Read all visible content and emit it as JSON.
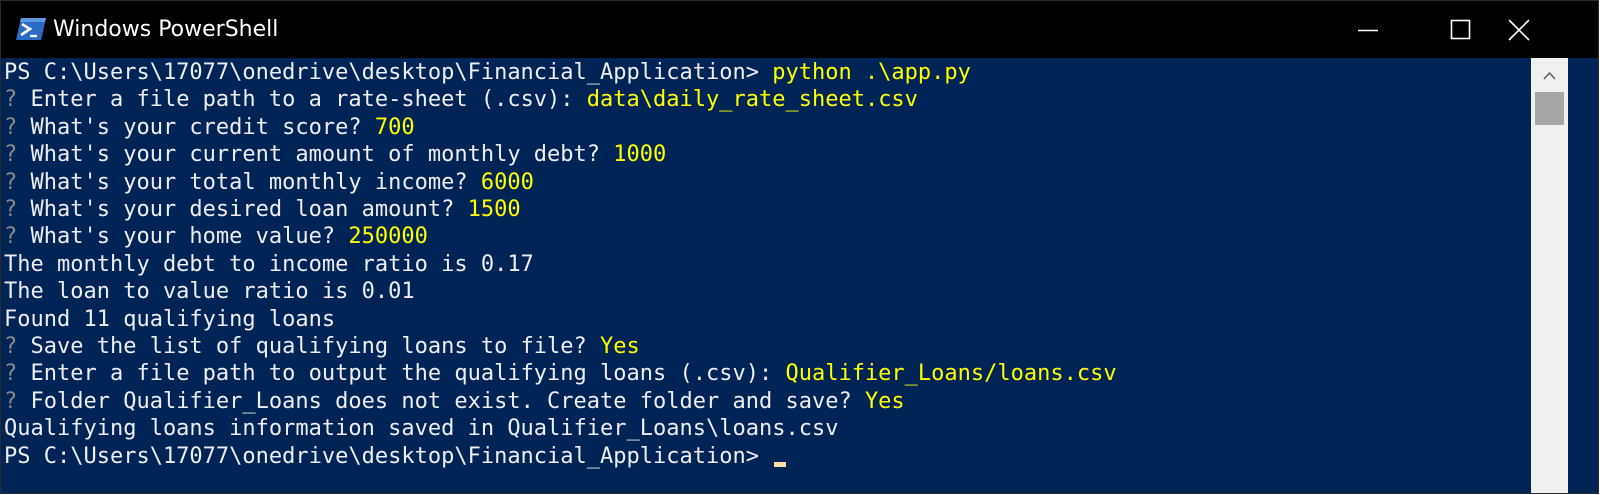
{
  "window": {
    "title": "Windows PowerShell",
    "icon": "powershell-icon",
    "controls": [
      "minimize-icon",
      "maximize-icon",
      "close-icon"
    ]
  },
  "colors": {
    "console_bg": "#012456",
    "text": "#eeedf0",
    "highlight": "#ffff00",
    "prompt_marker": "#8a8a8a",
    "titlebar_bg": "#000000",
    "cursor": "#fedba9"
  },
  "console": {
    "lines": [
      {
        "prefix": "PS C:\\Users\\17077\\onedrive\\desktop\\Financial_Application> ",
        "value": "python .\\app.py"
      },
      {
        "prefix": " Enter a file path to a rate-sheet (.csv): ",
        "value": "data\\daily_rate_sheet.csv"
      },
      {
        "prefix": " What's your credit score? ",
        "value": "700"
      },
      {
        "prefix": " What's your current amount of monthly debt? ",
        "value": "1000"
      },
      {
        "prefix": " What's your total monthly income? ",
        "value": "6000"
      },
      {
        "prefix": " What's your desired loan amount? ",
        "value": "1500"
      },
      {
        "prefix": " What's your home value? ",
        "value": "250000"
      },
      {
        "text": "The monthly debt to income ratio is 0.17"
      },
      {
        "text": "The loan to value ratio is 0.01"
      },
      {
        "text": "Found 11 qualifying loans"
      },
      {
        "prefix": " Save the list of qualifying loans to file? ",
        "value": "Yes"
      },
      {
        "prefix": " Enter a file path to output the qualifying loans (.csv): ",
        "value": "Qualifier_Loans/loans.csv"
      },
      {
        "prefix": " Folder Qualifier_Loans does not exist. Create folder and save? ",
        "value": "Yes"
      },
      {
        "text": "Qualifying loans information saved in Qualifier_Loans\\loans.csv"
      },
      {
        "text": "PS C:\\Users\\17077\\onedrive\\desktop\\Financial_Application> "
      }
    ],
    "question_marker": "?"
  }
}
